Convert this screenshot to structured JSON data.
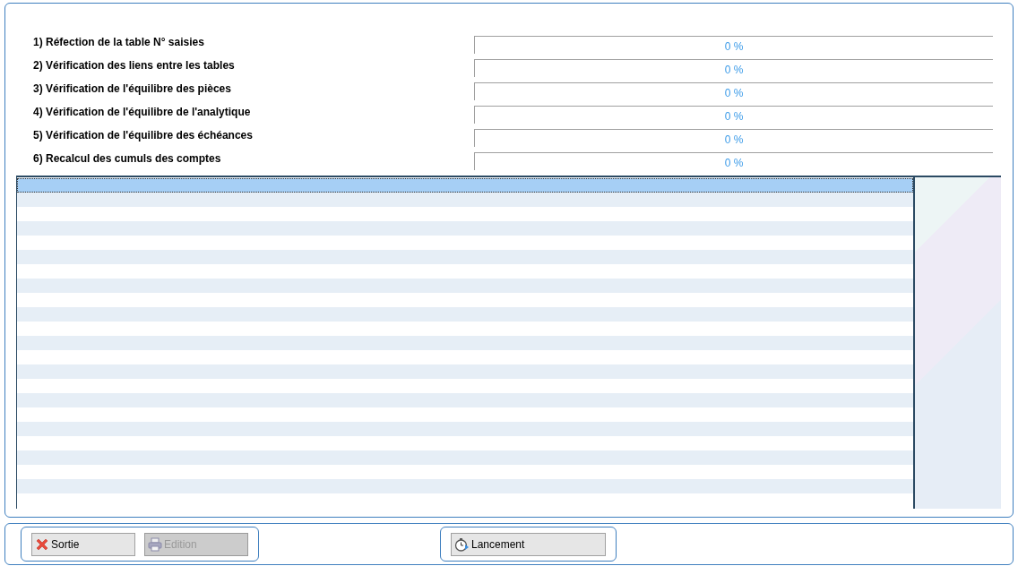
{
  "steps": [
    {
      "label": "1) Réfection de la table N° saisies",
      "level": 0,
      "reading": "0 %"
    },
    {
      "label": "2) Vérification des liens entre les tables",
      "level": 0,
      "reading": "0 %"
    },
    {
      "label": "3) Vérification de l'équilibre des pièces",
      "level": 0,
      "reading": "0 %"
    },
    {
      "label": "4) Vérification de l'équilibre de l'analytique",
      "level": 0,
      "reading": "0 %"
    },
    {
      "label": "5) Vérification de l'équilibre des échéances",
      "level": 0,
      "reading": "0 %"
    },
    {
      "label": "6) Recalcul des cumuls des comptes",
      "level": 0,
      "reading": "0 %"
    }
  ],
  "grid": {
    "rows": [
      {
        "selected": true
      },
      {
        "selected": false
      },
      {
        "selected": false
      },
      {
        "selected": false
      },
      {
        "selected": false
      },
      {
        "selected": false
      },
      {
        "selected": false
      },
      {
        "selected": false
      },
      {
        "selected": false
      },
      {
        "selected": false
      },
      {
        "selected": false
      },
      {
        "selected": false
      },
      {
        "selected": false
      },
      {
        "selected": false
      },
      {
        "selected": false
      },
      {
        "selected": false
      },
      {
        "selected": false
      },
      {
        "selected": false
      },
      {
        "selected": false
      },
      {
        "selected": false
      },
      {
        "selected": false
      },
      {
        "selected": false
      },
      {
        "selected": false
      }
    ]
  },
  "button_groups": [
    {
      "buttons": [
        {
          "label": "Sortie",
          "kind": "exit",
          "disabled": false
        },
        {
          "label": "Edition",
          "kind": "print",
          "disabled": true
        }
      ]
    },
    {
      "buttons": [
        {
          "label": "Lancement",
          "kind": "launch",
          "disabled": false
        }
      ]
    }
  ]
}
